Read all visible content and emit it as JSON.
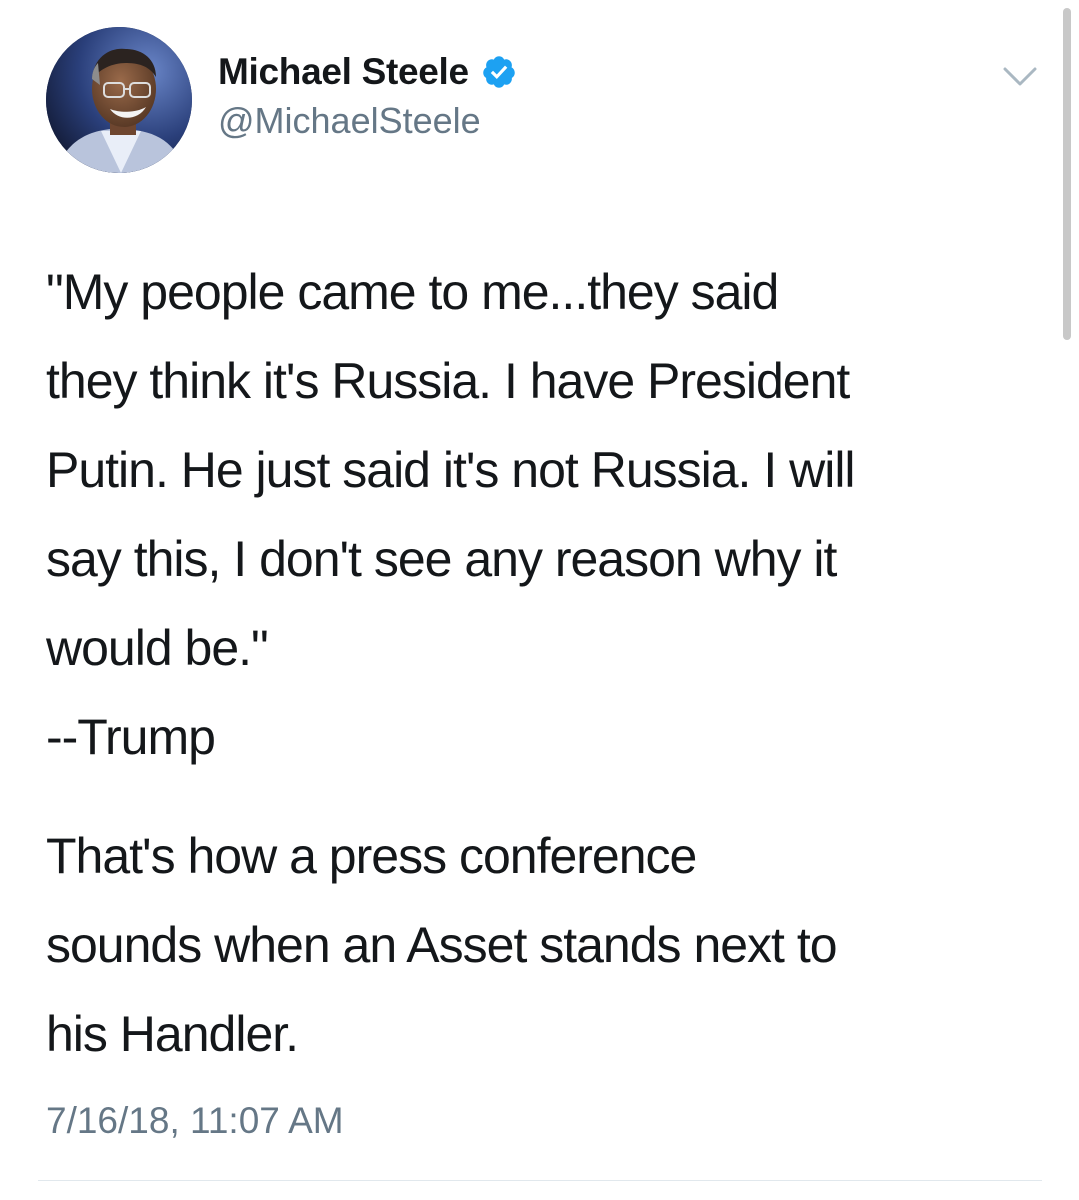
{
  "author": {
    "display_name": "Michael Steele",
    "handle": "@MichaelSteele",
    "verified": true,
    "avatar_icon": "profile-photo",
    "verified_icon": "verified-badge-icon",
    "verified_color": "#1da1f2"
  },
  "menu_icon": "chevron-down-icon",
  "tweet": {
    "quote_lines": [
      "\"My people came to me...they said",
      "they think it's Russia. I have President",
      "Putin. He just said it's not Russia. I will",
      "say this, I don't see any reason why it",
      "would be.\"",
      "--Trump"
    ],
    "comment_lines": [
      "That's how a press conference",
      "sounds when an Asset stands next to",
      "his Handler."
    ],
    "timestamp": "7/16/18, 11:07 AM"
  },
  "colors": {
    "text": "#14171a",
    "secondary_text": "#657786",
    "divider": "#e1e8ed"
  }
}
